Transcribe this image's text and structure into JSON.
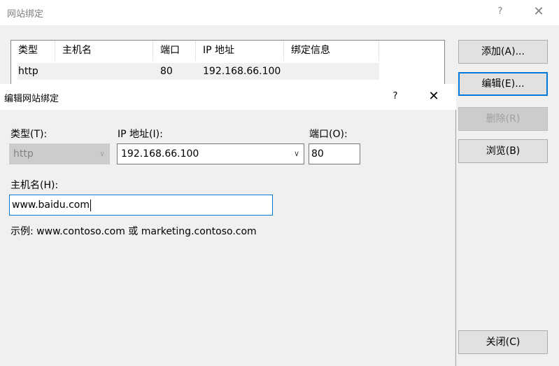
{
  "outer": {
    "title": "网站绑定",
    "help": "?",
    "close": "✕",
    "table": {
      "headers": [
        "类型",
        "主机名",
        "端口",
        "IP 地址",
        "绑定信息"
      ],
      "rows": [
        {
          "type": "http",
          "host": "",
          "port": "80",
          "ip": "192.168.66.100",
          "binding": ""
        }
      ]
    },
    "buttons": {
      "add": "添加(A)...",
      "edit": "编辑(E)...",
      "remove": "删除(R)",
      "browse": "浏览(B)",
      "close": "关闭(C)"
    }
  },
  "dialog": {
    "title": "编辑网站绑定",
    "help": "?",
    "close": "✕",
    "type_label": "类型(T):",
    "type_value": "http",
    "ip_label": "IP 地址(I):",
    "ip_value": "192.168.66.100",
    "port_label": "端口(O):",
    "port_value": "80",
    "host_label": "主机名(H):",
    "host_value": "www.baidu.com",
    "example": "示例: www.contoso.com 或 marketing.contoso.com"
  },
  "icons": {
    "dropdown": "chevron-down-icon",
    "help": "help-icon",
    "close": "close-icon"
  },
  "colors": {
    "focus_border": "#0078d7",
    "dialog_bg": "#f0f0f0",
    "disabled_text": "#a0a0a0"
  }
}
